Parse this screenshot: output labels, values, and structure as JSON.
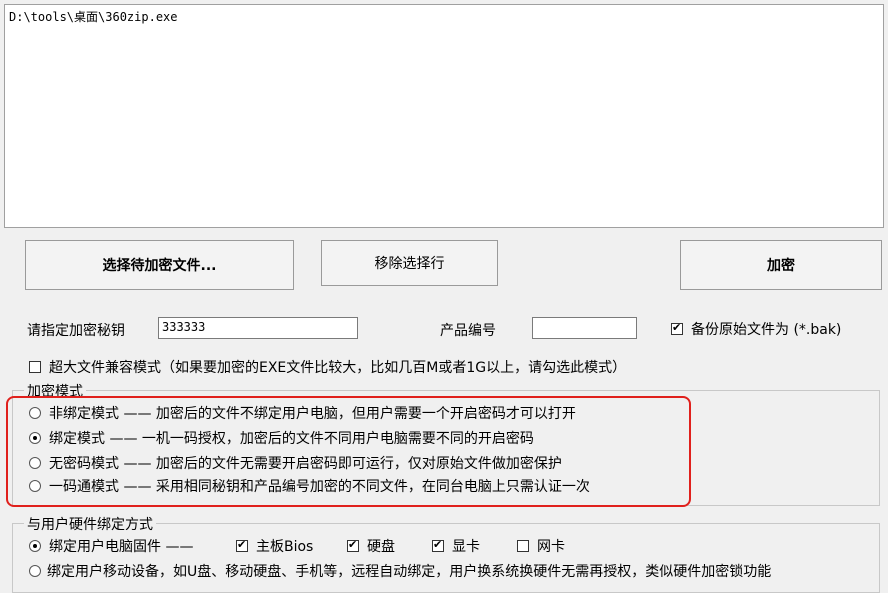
{
  "filelist": {
    "line": "D:\\tools\\桌面\\360zip.exe"
  },
  "buttons": {
    "select_files": "选择待加密文件...",
    "remove_row": "移除选择行",
    "encrypt": "加密"
  },
  "key": {
    "label": "请指定加密秘钥",
    "value": "333333"
  },
  "product": {
    "label": "产品编号",
    "value": ""
  },
  "backup": {
    "label": "备份原始文件为 (*.bak)",
    "checked": true
  },
  "large_file": {
    "label": "超大文件兼容模式（如果要加密的EXE文件比较大，比如几百M或者1G以上，请勾选此模式）",
    "checked": false
  },
  "encrypt_mode": {
    "title": "加密模式",
    "options": [
      {
        "label": "非绑定模式 —— 加密后的文件不绑定用户电脑，但用户需要一个开启密码才可以打开",
        "checked": false
      },
      {
        "label": "绑定模式 —— 一机一码授权，加密后的文件不同用户电脑需要不同的开启密码",
        "checked": true
      },
      {
        "label": "无密码模式 —— 加密后的文件无需要开启密码即可运行，仅对原始文件做加密保护",
        "checked": false
      },
      {
        "label": "一码通模式 —— 采用相同秘钥和产品编号加密的不同文件，在同台电脑上只需认证一次",
        "checked": false
      }
    ]
  },
  "hardware": {
    "title": "与用户硬件绑定方式",
    "firmware_label": "绑定用户电脑固件 ——",
    "firmware_checked": true,
    "items": [
      {
        "label": "主板Bios",
        "checked": true
      },
      {
        "label": "硬盘",
        "checked": true
      },
      {
        "label": "显卡",
        "checked": true
      },
      {
        "label": "网卡",
        "checked": false
      }
    ],
    "mobile_label": "绑定用户移动设备，如U盘、移动硬盘、手机等，远程自动绑定，用户换系统换硬件无需再授权，类似硬件加密锁功能",
    "mobile_checked": false
  },
  "colors": {
    "highlight": "#e0201c"
  }
}
